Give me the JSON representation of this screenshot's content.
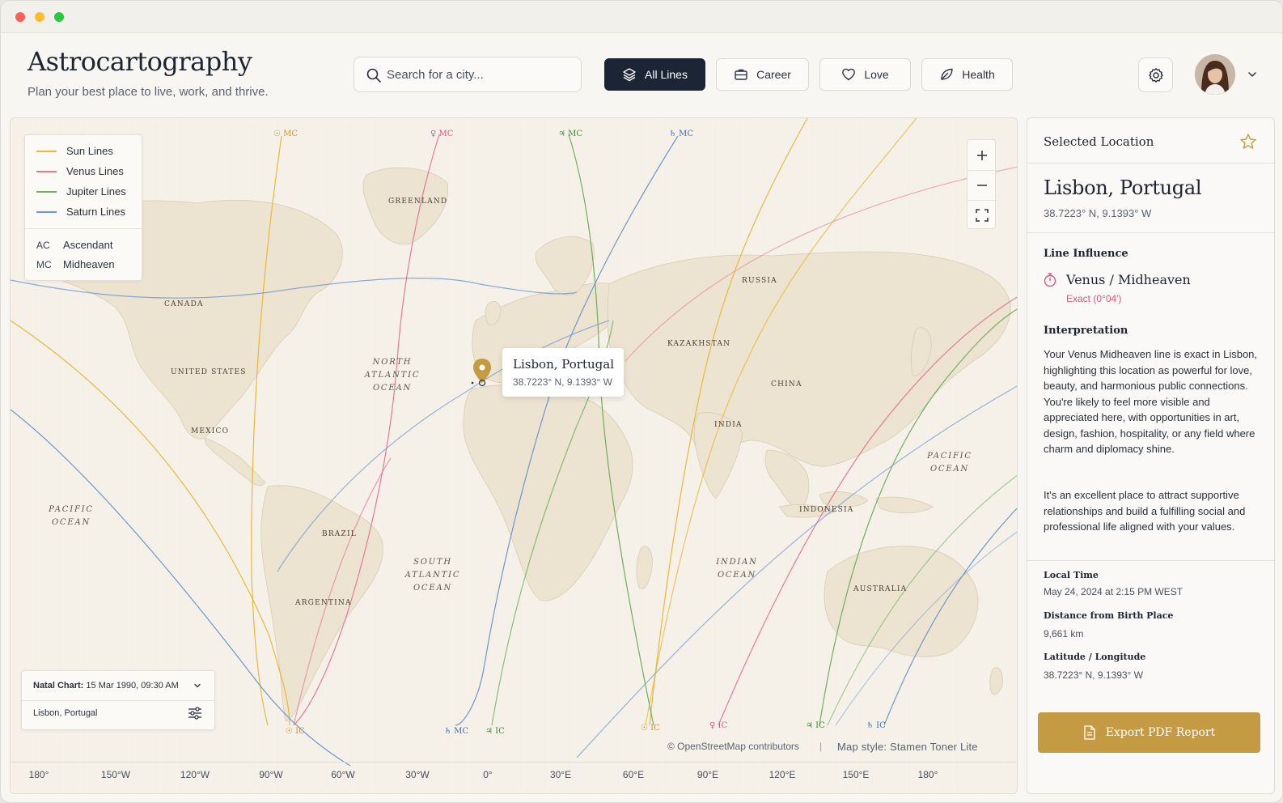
{
  "app": {
    "title": "Astrocartography",
    "subtitle": "Plan your best place to live, work, and thrive."
  },
  "search": {
    "placeholder": "Search for a city..."
  },
  "filters": {
    "all_lines": "All Lines",
    "career": "Career",
    "love": "Love",
    "health": "Health",
    "active": "All Lines"
  },
  "icons": {
    "search": "search-icon",
    "layers": "layers-icon",
    "briefcase": "briefcase-icon",
    "heart": "heart-icon",
    "leaf": "leaf-icon",
    "gear": "gear-icon",
    "chevron": "chevron-down-icon",
    "star": "star-icon",
    "pin": "map-pin-icon",
    "document": "document-icon",
    "sliders": "sliders-icon"
  },
  "colors": {
    "sun": "#e8b93a",
    "venus": "#e27b98",
    "jupiter": "#6fae5f",
    "saturn": "#6f96cf",
    "accent": "#c49a42",
    "dark_button": "#1c2536"
  },
  "legend": {
    "lines": [
      {
        "label": "Sun Lines",
        "color": "#e8b93a"
      },
      {
        "label": "Venus Lines",
        "color": "#e27b98"
      },
      {
        "label": "Jupiter Lines",
        "color": "#6fae5f"
      },
      {
        "label": "Saturn Lines",
        "color": "#6f96cf"
      }
    ],
    "angles": [
      {
        "abbr": "AC",
        "label": "Ascendant"
      },
      {
        "abbr": "MC",
        "label": "Midheaven"
      }
    ]
  },
  "map": {
    "regions": {
      "greenland": "GREENLAND",
      "canada": "CANADA",
      "united_states": "UNITED STATES",
      "mexico": "MEXICO",
      "brazil": "BRAZIL",
      "argentina": "ARGENTINA",
      "russia": "RUSSIA",
      "kazakhstan": "KAZAKHSTAN",
      "china": "CHINA",
      "india": "INDIA",
      "indonesia": "INDONESIA",
      "australia": "AUSTRALIA"
    },
    "oceans": {
      "north_atlantic": [
        "NORTH",
        "ATLANTIC",
        "OCEAN"
      ],
      "south_atlantic": [
        "SOUTH",
        "ATLANTIC",
        "OCEAN"
      ],
      "pacific_west": [
        "PACIFIC",
        "OCEAN"
      ],
      "pacific_east": [
        "PACIFIC",
        "OCEAN"
      ],
      "indian": [
        "INDIAN",
        "OCEAN"
      ]
    },
    "line_labels": {
      "sun_mc_top": "☉ MC",
      "venus_mc_top": "♀ MC",
      "jupiter_mc_top": "♃ MC",
      "saturn_mc_top": "♄ MC",
      "sun_ic_left": "☉ IC",
      "saturn_mc_bottom": "♄ MC",
      "jupiter_ic_bottom": "♃ IC",
      "sun_ic_right": "☉ IC",
      "venus_ic_bottom": "♀ IC",
      "jupiter_ic_right": "♃ IC",
      "saturn_ic_right": "♄ IC"
    },
    "popup": {
      "title": "Lisbon, Portugal",
      "coords": "38.7223° N, 9.1393° W"
    },
    "natal": {
      "label": "Natal Chart:",
      "value": "15 Mar 1990, 09:30 AM",
      "location": "Lisbon, Portugal"
    },
    "attribution": "© OpenStreetMap contributors",
    "separator": "|",
    "map_style": "Map style: Stamen Toner Lite",
    "longitude_ticks": [
      "180°",
      "150°W",
      "120°W",
      "90°W",
      "60°W",
      "30°W",
      "0°",
      "30°E",
      "60°E",
      "90°E",
      "120°E",
      "150°E",
      "180°"
    ]
  },
  "panel": {
    "header": "Selected Location",
    "location_name": "Lisbon, Portugal",
    "location_coords": "38.7223° N, 9.1393° W",
    "influence_title": "Line Influence",
    "influence_name": "Venus / Midheaven",
    "influence_exact": "Exact (0°04′)",
    "interpretation_title": "Interpretation",
    "interpretation_p1": "Your Venus Midheaven line is exact in Lisbon, highlighting this location as powerful for love, beauty, and harmonious public connections. You're likely to feel more visible and appreciated here, with opportunities in art, design, fashion, hospitality, or any field where charm and diplomacy shine.",
    "interpretation_p2": "It's an excellent place to attract supportive relationships and build a fulfilling social and professional life aligned with your values.",
    "local_time_label": "Local Time",
    "local_time_value": "May 24, 2024 at 2:15 PM WEST",
    "distance_label": "Distance from Birth Place",
    "distance_value": "9,661 km",
    "latlon_label": "Latitude / Longitude",
    "latlon_value": "38.7223° N, 9.1393° W",
    "export_label": "Export PDF Report"
  }
}
